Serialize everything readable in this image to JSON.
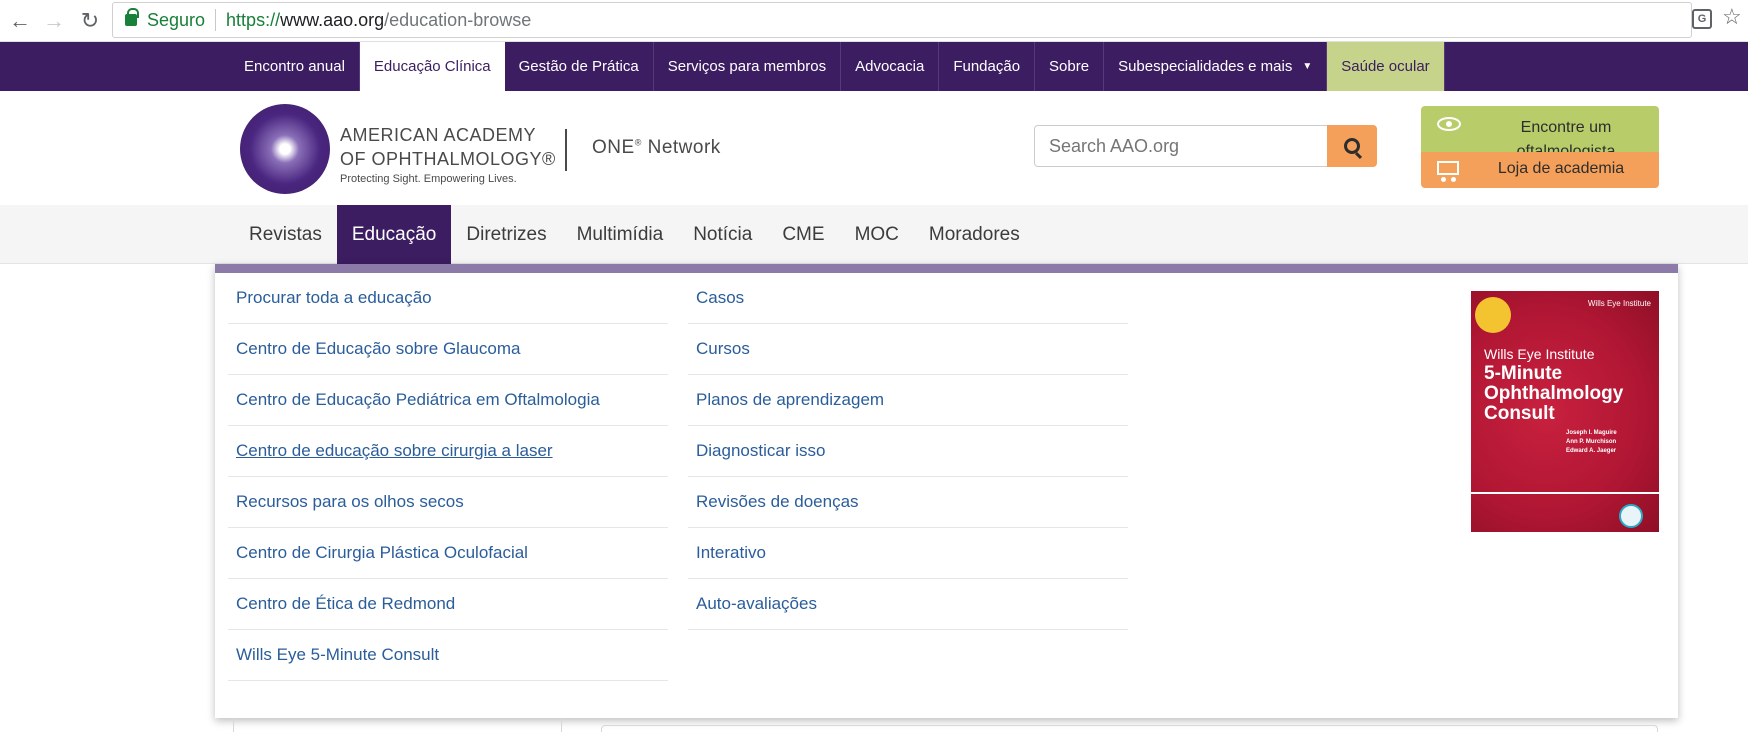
{
  "browser": {
    "secure_label": "Seguro",
    "url_scheme": "https://",
    "url_host": "www.aao.org",
    "url_path": "/education-browse"
  },
  "topnav": {
    "items": [
      {
        "label": "Encontro anual"
      },
      {
        "label": "Educação Clínica",
        "active": true
      },
      {
        "label": "Gestão de Prática"
      },
      {
        "label": "Serviços para membros"
      },
      {
        "label": "Advocacia"
      },
      {
        "label": "Fundação"
      },
      {
        "label": "Sobre"
      },
      {
        "label": "Subespecialidades e mais"
      },
      {
        "label": "Saúde ocular"
      }
    ]
  },
  "header": {
    "logo_line1": "AMERICAN ACADEMY",
    "logo_line2": "OF OPHTHALMOLOGY®",
    "logo_tagline": "Protecting Sight. Empowering Lives.",
    "network_name": "ONE",
    "network_suffix": "Network",
    "network_sup": "®",
    "search_placeholder": "Search AAO.org",
    "find_label": "Encontre um oftalmologista",
    "shop_label": "Loja de academia"
  },
  "secnav": {
    "items": [
      {
        "label": "Revistas"
      },
      {
        "label": "Educação",
        "active": true
      },
      {
        "label": "Diretrizes"
      },
      {
        "label": "Multimídia"
      },
      {
        "label": "Notícia"
      },
      {
        "label": "CME"
      },
      {
        "label": "MOC"
      },
      {
        "label": "Moradores"
      }
    ]
  },
  "dropdown": {
    "left": [
      "Procurar toda a educação",
      "Centro de Educação sobre Glaucoma",
      "Centro de Educação Pediátrica em Oftalmologia",
      "Centro de educação sobre cirurgia a laser",
      "Recursos para os olhos secos",
      "Centro de Cirurgia Plástica Oculofacial",
      "Centro de Ética de Redmond",
      "Wills Eye 5-Minute Consult"
    ],
    "middle": [
      "Casos",
      "Cursos",
      "Planos de aprendizagem",
      "Diagnosticar isso",
      "Revisões de doenças",
      "Interativo",
      "Auto-avaliações"
    ],
    "book": {
      "brand": "Wills Eye Institute",
      "small": "Wills Eye Institute",
      "title": "5-Minute Ophthalmology Consult",
      "authors": "Joseph I. Maguire\nAnn P. Murchison\nEdward A. Jaeger"
    }
  }
}
